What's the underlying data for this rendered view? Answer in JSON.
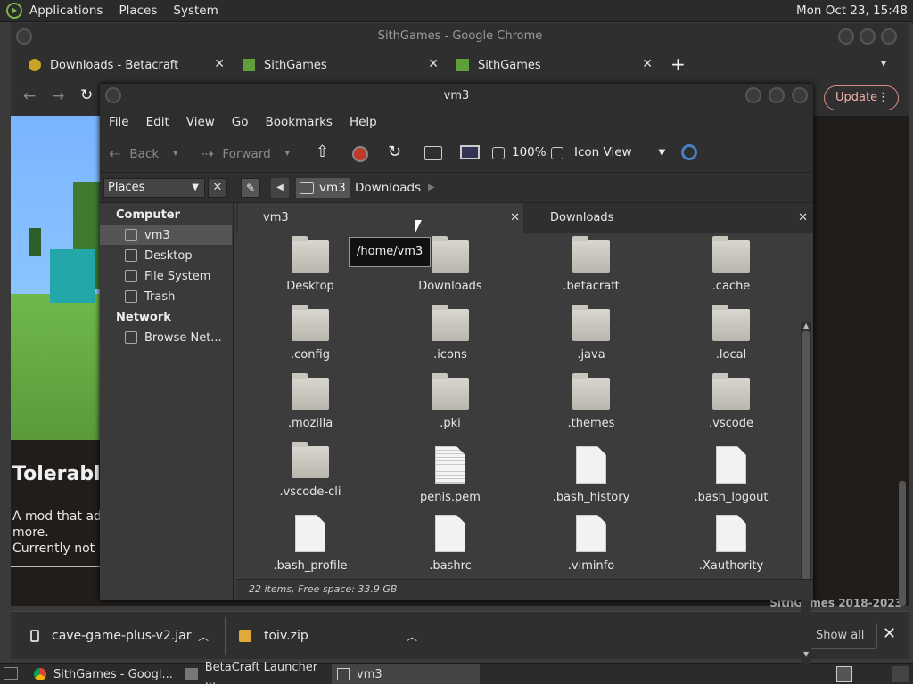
{
  "system_panel": {
    "menus": [
      "Applications",
      "Places",
      "System"
    ],
    "clock": "Mon Oct 23, 15:48"
  },
  "chrome": {
    "title": "SithGames - Google Chrome",
    "tabs": [
      {
        "label": "Downloads - Betacraft"
      },
      {
        "label": "SithGames"
      },
      {
        "label": "SithGames"
      }
    ],
    "new_tab": "+",
    "update_label": "Update",
    "page": {
      "heading": "Tolerable",
      "text_line1": "A mod that ad",
      "text_line2": "more.",
      "text_line3": "Currently not i",
      "footer": "SithGames 2018-2023"
    },
    "downloads": [
      {
        "name": "cave-game-plus-v2.jar"
      },
      {
        "name": "toiv.zip"
      }
    ],
    "show_all": "Show all"
  },
  "taskbar": {
    "items": [
      {
        "label": "SithGames - Googl..."
      },
      {
        "label": "BetaCraft Launcher ..."
      },
      {
        "label": "vm3"
      }
    ]
  },
  "file_manager": {
    "title": "vm3",
    "menus": [
      "File",
      "Edit",
      "View",
      "Go",
      "Bookmarks",
      "Help"
    ],
    "toolbar": {
      "back": "Back",
      "forward": "Forward",
      "zoom": "100%",
      "view_mode": "Icon View"
    },
    "sidebar_combo": "Places",
    "breadcrumb": [
      "vm3",
      "Downloads"
    ],
    "sidebar": {
      "computer_heading": "Computer",
      "computer_items": [
        "vm3",
        "Desktop",
        "File System",
        "Trash"
      ],
      "network_heading": "Network",
      "network_items": [
        "Browse Net..."
      ]
    },
    "pane_tabs": [
      "vm3",
      "Downloads"
    ],
    "items": [
      {
        "name": "Desktop",
        "type": "folder"
      },
      {
        "name": "Downloads",
        "type": "folder"
      },
      {
        "name": ".betacraft",
        "type": "folder"
      },
      {
        "name": ".cache",
        "type": "folder"
      },
      {
        "name": ".config",
        "type": "folder"
      },
      {
        "name": ".icons",
        "type": "folder"
      },
      {
        "name": ".java",
        "type": "folder"
      },
      {
        "name": ".local",
        "type": "folder"
      },
      {
        "name": ".mozilla",
        "type": "folder"
      },
      {
        "name": ".pki",
        "type": "folder"
      },
      {
        "name": ".themes",
        "type": "folder"
      },
      {
        "name": ".vscode",
        "type": "folder"
      },
      {
        "name": ".vscode-cli",
        "type": "folder"
      },
      {
        "name": "penis.pem",
        "type": "text"
      },
      {
        "name": ".bash_history",
        "type": "file"
      },
      {
        "name": ".bash_logout",
        "type": "file"
      },
      {
        "name": ".bash_profile",
        "type": "file"
      },
      {
        "name": ".bashrc",
        "type": "file"
      },
      {
        "name": ".viminfo",
        "type": "file"
      },
      {
        "name": ".Xauthority",
        "type": "file"
      }
    ],
    "status": "22 items, Free space: 33.9 GB",
    "tooltip": "/home/vm3"
  },
  "colors": {
    "accent_update": "#d98c86",
    "stop_button": "#c0392b"
  }
}
